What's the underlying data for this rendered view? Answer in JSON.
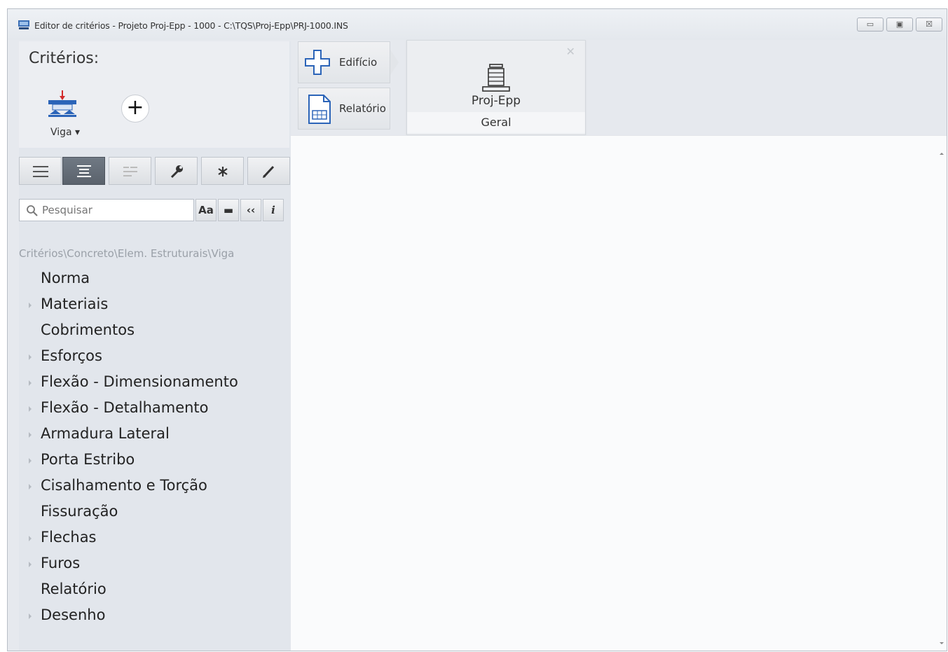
{
  "window": {
    "title": "Editor de critérios - Projeto Proj-Epp - 1000 - C:\\TQS\\Proj-Epp\\PRJ-1000.INS",
    "min_icon": "minimize-icon",
    "max_icon": "maximize-icon",
    "close_icon": "close-icon"
  },
  "criteria": {
    "title": "Critérios:",
    "element_label": "Viga ▾",
    "element_icon": "beam-icon",
    "add_icon": "plus-icon"
  },
  "toolbar": {
    "icons": [
      "list-icon",
      "tree-icon",
      "filter-icon",
      "wrench-icon",
      "asterisk-icon",
      "pencil-icon"
    ],
    "active_index": 1
  },
  "search": {
    "placeholder": "Pesquisar",
    "case_label": "Aa",
    "whole_label": "▬",
    "quote_label": "‹‹",
    "info_label": "i"
  },
  "breadcrumb": "Critérios\\Concreto\\Elem. Estruturais\\Viga",
  "tree": {
    "items": [
      {
        "label": "Norma",
        "expandable": false
      },
      {
        "label": "Materiais",
        "expandable": true
      },
      {
        "label": "Cobrimentos",
        "expandable": false
      },
      {
        "label": "Esforços",
        "expandable": true
      },
      {
        "label": "Flexão - Dimensionamento",
        "expandable": true
      },
      {
        "label": "Flexão - Detalhamento",
        "expandable": true
      },
      {
        "label": "Armadura Lateral",
        "expandable": true
      },
      {
        "label": "Porta Estribo",
        "expandable": true
      },
      {
        "label": "Cisalhamento e Torção",
        "expandable": true
      },
      {
        "label": "Fissuração",
        "expandable": false
      },
      {
        "label": "Flechas",
        "expandable": true
      },
      {
        "label": "Furos",
        "expandable": true
      },
      {
        "label": "Relatório",
        "expandable": false
      },
      {
        "label": "Desenho",
        "expandable": true
      }
    ]
  },
  "tabs": {
    "edificio": "Edifício",
    "relatorio": "Relatório"
  },
  "project": {
    "name": "Proj-Epp",
    "subtitle": "Geral",
    "icon": "building-icon"
  },
  "colors": {
    "accent_red": "#d22b2b",
    "beam_blue": "#2b64b8",
    "active_toolbar": "#5f6771"
  }
}
